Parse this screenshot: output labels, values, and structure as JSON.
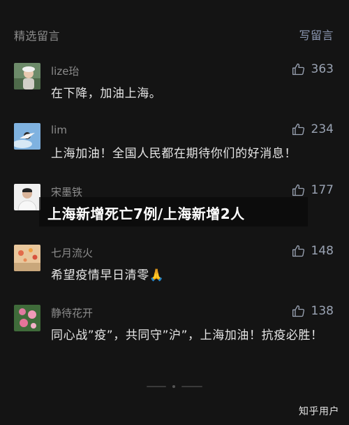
{
  "header": {
    "title": "精选留言",
    "write_label": "写留言"
  },
  "comments": [
    {
      "username": "lize珆",
      "content": "在下降，加油上海。",
      "likes": "363",
      "avatar_icon": "person-with-hat-avatar"
    },
    {
      "username": "lim",
      "content": "上海加油！全国人民都在期待你们的好消息！",
      "likes": "234",
      "avatar_icon": "blue-sky-avatar"
    },
    {
      "username": "宋墨铁",
      "content": "",
      "likes": "177",
      "avatar_icon": "portrait-avatar"
    },
    {
      "username": "七月流火",
      "content": "希望疫情早日清零🙏",
      "likes": "148",
      "avatar_icon": "balloons-avatar"
    },
    {
      "username": "静待花开",
      "content": "同心战”疫”，共同守”沪”，上海加油！抗疫必胜！",
      "likes": "138",
      "avatar_icon": "flowers-avatar"
    }
  ],
  "overlay": {
    "headline": "上海新增死亡7例/上海新增2人"
  },
  "watermark": {
    "text": "知乎用户"
  },
  "colors": {
    "background": "#141414",
    "accent": "#8c98b3",
    "text_primary": "#e6e6e6",
    "text_secondary": "#8c8c8c"
  }
}
